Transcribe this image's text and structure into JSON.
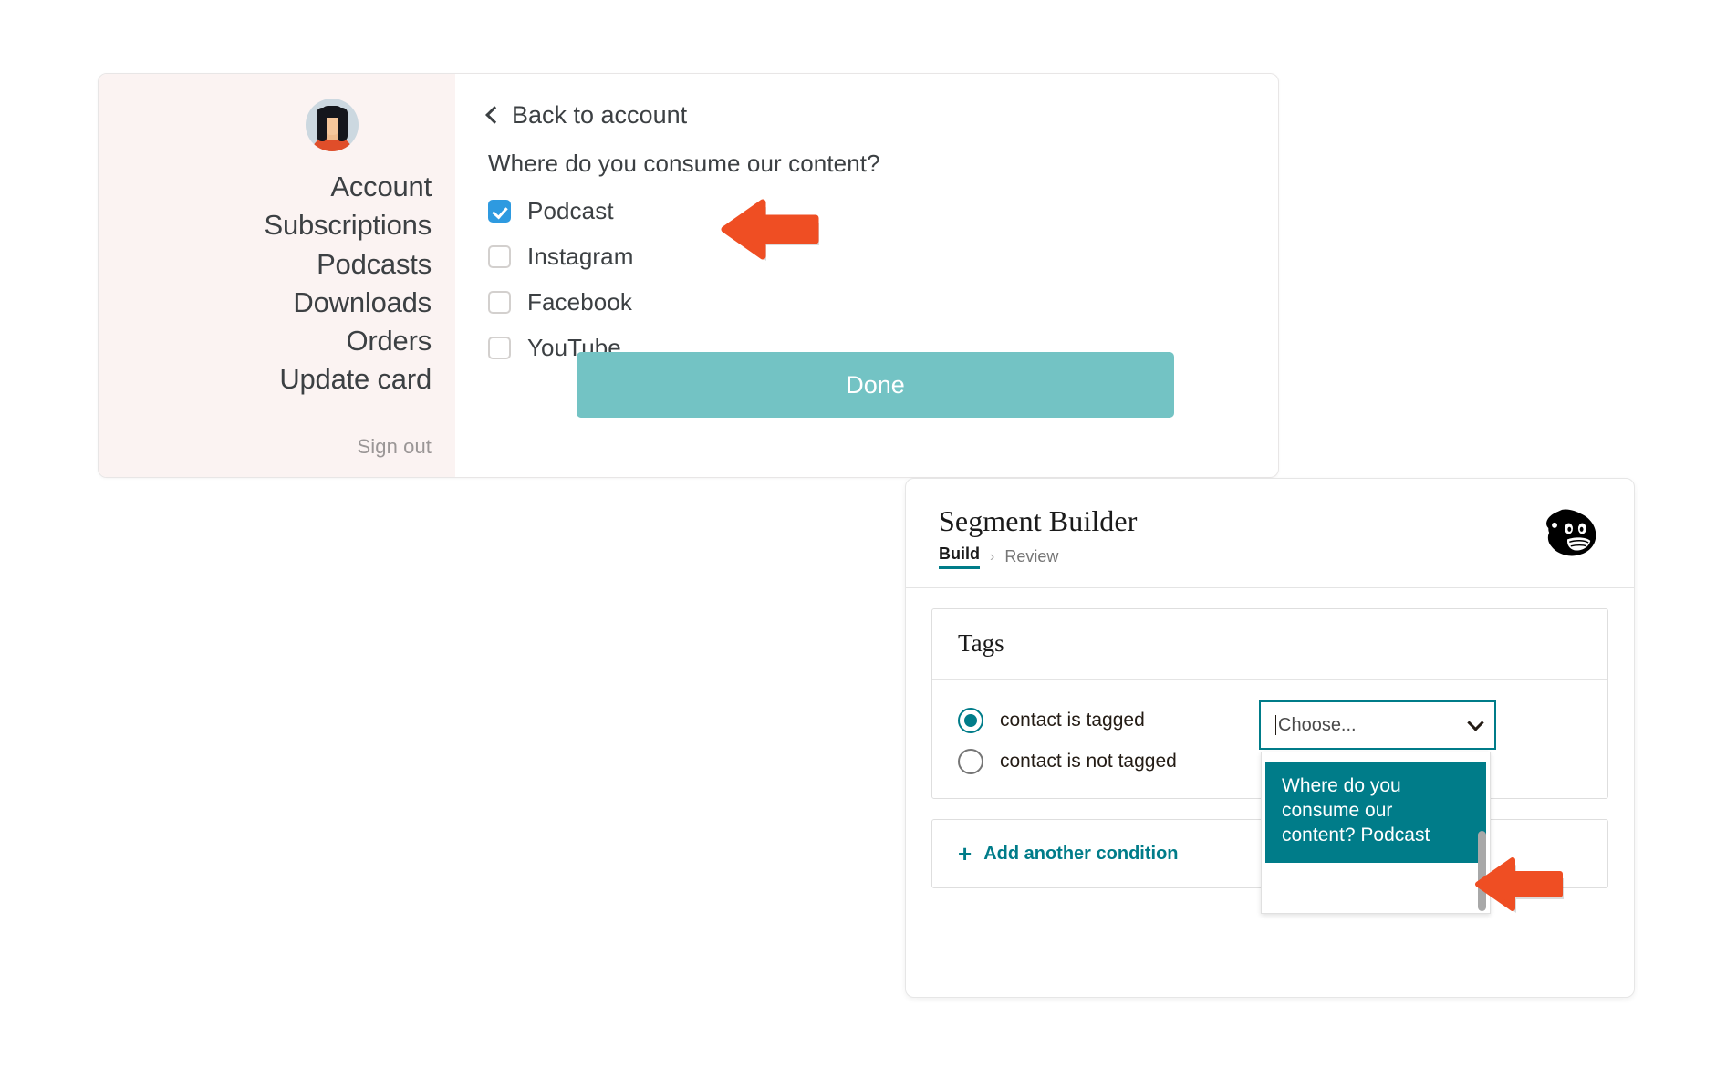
{
  "account_card": {
    "sidebar": {
      "avatar_alt": "user-avatar",
      "nav_items": [
        {
          "label": "Account"
        },
        {
          "label": "Subscriptions"
        },
        {
          "label": "Podcasts"
        },
        {
          "label": "Downloads"
        },
        {
          "label": "Orders"
        },
        {
          "label": "Update card"
        }
      ],
      "sign_out_label": "Sign out"
    },
    "main": {
      "back_link_label": "Back to account",
      "question": "Where do you consume our content?",
      "checkboxes": [
        {
          "label": "Podcast",
          "checked": true
        },
        {
          "label": "Instagram",
          "checked": false
        },
        {
          "label": "Facebook",
          "checked": false
        },
        {
          "label": "YouTube",
          "checked": false
        }
      ],
      "done_button_label": "Done"
    }
  },
  "segment_panel": {
    "title": "Segment Builder",
    "breadcrumbs": [
      {
        "label": "Build",
        "active": true
      },
      {
        "label": "Review",
        "active": false
      }
    ],
    "breadcrumb_separator": "›",
    "logo_name": "mailchimp-freddie-logo",
    "condition": {
      "heading": "Tags",
      "radios": [
        {
          "label": "contact is tagged",
          "selected": true
        },
        {
          "label": "contact is not tagged",
          "selected": false
        }
      ],
      "select": {
        "placeholder": "Choose...",
        "value": "",
        "options": [
          {
            "label": "Where do you consume our content? Podcast",
            "highlighted": true
          }
        ]
      }
    },
    "add_condition_label": "Add another condition",
    "plus_glyph": "+"
  },
  "colors": {
    "sidebar_bg": "#fbf3f2",
    "done_button": "#73c3c4",
    "checkbox_checked": "#2e9ae0",
    "mailchimp_teal": "#007c89",
    "arrow_orange": "#ef4e23"
  }
}
